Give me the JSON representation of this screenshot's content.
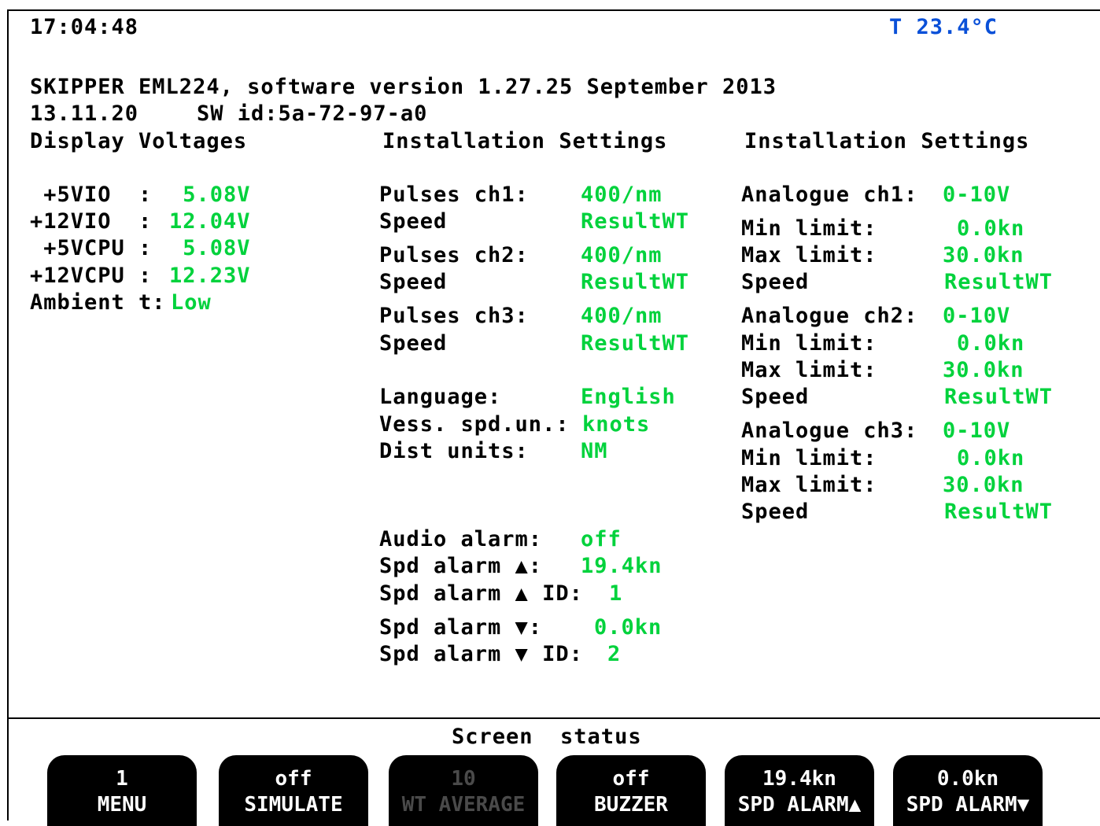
{
  "header": {
    "time": "17:04:48",
    "temperature": "T 23.4°C"
  },
  "info": {
    "line1": "SKIPPER EML224, software version 1.27.25 September 2013",
    "date": "13.11.20",
    "sw_id": "SW id:5a-72-97-a0"
  },
  "display_voltages": {
    "title": "Display Voltages",
    "rows": [
      {
        "label": " +5VIO  :",
        "value": " 5.08V"
      },
      {
        "label": "+12VIO  :",
        "value": "12.04V"
      },
      {
        "label": " +5VCPU :",
        "value": " 5.08V"
      },
      {
        "label": "+12VCPU :",
        "value": "12.23V"
      },
      {
        "label": "Ambient t:",
        "value": "Low"
      }
    ]
  },
  "installation_1": {
    "title": "Installation Settings",
    "rows": [
      {
        "label": "Pulses ch1:",
        "value": "400/nm"
      },
      {
        "label": "Speed",
        "value": "ResultWT"
      },
      {
        "label": "Pulses ch2:",
        "value": "400/nm"
      },
      {
        "label": "Speed",
        "value": "ResultWT"
      },
      {
        "label": "Pulses ch3:",
        "value": "400/nm"
      },
      {
        "label": "Speed",
        "value": "ResultWT"
      },
      {
        "label": "Language:",
        "value": "English"
      },
      {
        "label": "Vess. spd.un.:",
        "value": "knots"
      },
      {
        "label": "Dist units:",
        "value": "NM"
      },
      {
        "label": "Audio alarm:",
        "value": "off"
      },
      {
        "label": "Spd alarm ▲:",
        "value": "19.4kn"
      },
      {
        "label": "Spd alarm ▲ ID:",
        "value": "1"
      },
      {
        "label": "Spd alarm ▼:",
        "value": "0.0kn"
      },
      {
        "label": "Spd alarm ▼ ID:",
        "value": "2"
      }
    ]
  },
  "installation_2": {
    "title": "Installation Settings",
    "rows": [
      {
        "label": "Analogue ch1:",
        "value": "0-10V"
      },
      {
        "label": "Min limit:",
        "value": "0.0kn"
      },
      {
        "label": "Max limit:",
        "value": "30.0kn"
      },
      {
        "label": "Speed",
        "value": "ResultWT"
      },
      {
        "label": "Analogue ch2:",
        "value": "0-10V"
      },
      {
        "label": "Min limit:",
        "value": "0.0kn"
      },
      {
        "label": "Max limit:",
        "value": "30.0kn"
      },
      {
        "label": "Speed",
        "value": "ResultWT"
      },
      {
        "label": "Analogue ch3:",
        "value": "0-10V"
      },
      {
        "label": "Min limit:",
        "value": "0.0kn"
      },
      {
        "label": "Max limit:",
        "value": "30.0kn"
      },
      {
        "label": "Speed",
        "value": "ResultWT"
      }
    ]
  },
  "footer": {
    "title": "Screen  status",
    "softkeys": [
      {
        "value": "1",
        "label": "MENU"
      },
      {
        "value": "off",
        "label": "SIMULATE"
      },
      {
        "value": "10",
        "label": "WT AVERAGE"
      },
      {
        "value": "off",
        "label": "BUZZER"
      },
      {
        "value": "19.4kn",
        "label": "SPD ALARM▲"
      },
      {
        "value": "0.0kn",
        "label": "SPD ALARM▼"
      }
    ]
  },
  "colors": {
    "value_green": "#00d23c",
    "temp_blue": "#0a50d8",
    "softkey_bg": "#000000"
  }
}
